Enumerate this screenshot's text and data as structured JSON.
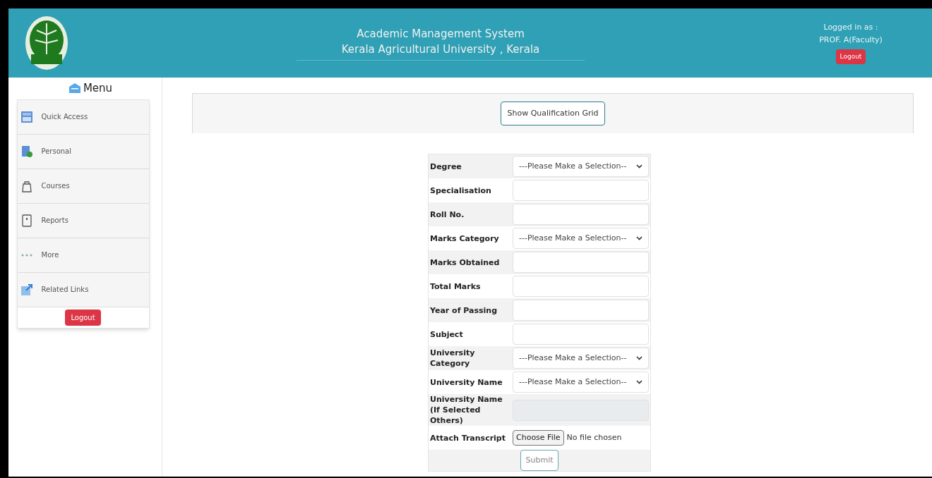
{
  "header": {
    "title": "Academic Management System",
    "subtitle": "Kerala Agricultural University , Kerala",
    "logged_in_label": "Logged in as :",
    "user": "PROF. A(Faculty)",
    "logout": "Logout"
  },
  "sidebar": {
    "title": "Menu",
    "items": [
      {
        "label": "Quick Access",
        "kind": "drawer"
      },
      {
        "label": "Personal",
        "kind": "person"
      },
      {
        "label": "Courses",
        "kind": "bag"
      },
      {
        "label": "Reports",
        "kind": "report"
      },
      {
        "label": "More",
        "kind": "dots"
      },
      {
        "label": "Related Links",
        "kind": "link"
      }
    ],
    "logout": "Logout"
  },
  "toolbar": {
    "button": "Show Qualification Grid"
  },
  "form": {
    "fields": [
      {
        "label": "Degree",
        "kind": "select",
        "placeholder": "---Please Make a Selection--"
      },
      {
        "label": "Specialisation",
        "kind": "text"
      },
      {
        "label": "Roll No.",
        "kind": "text"
      },
      {
        "label": "Marks Category",
        "kind": "select",
        "placeholder": "---Please Make a Selection--"
      },
      {
        "label": "Marks Obtained",
        "kind": "text"
      },
      {
        "label": "Total Marks",
        "kind": "text"
      },
      {
        "label": "Year of Passing",
        "kind": "text"
      },
      {
        "label": "Subject",
        "kind": "text"
      },
      {
        "label": "University Category",
        "kind": "select",
        "placeholder": "---Please Make a Selection--"
      },
      {
        "label": "University Name",
        "kind": "select",
        "placeholder": "---Please Make a Selection--"
      },
      {
        "label": "University Name (If Selected Others)",
        "kind": "disabled"
      },
      {
        "label": "Attach Transcript",
        "kind": "file",
        "button": "Choose File",
        "status": "No file chosen"
      }
    ],
    "submit": "Submit"
  }
}
